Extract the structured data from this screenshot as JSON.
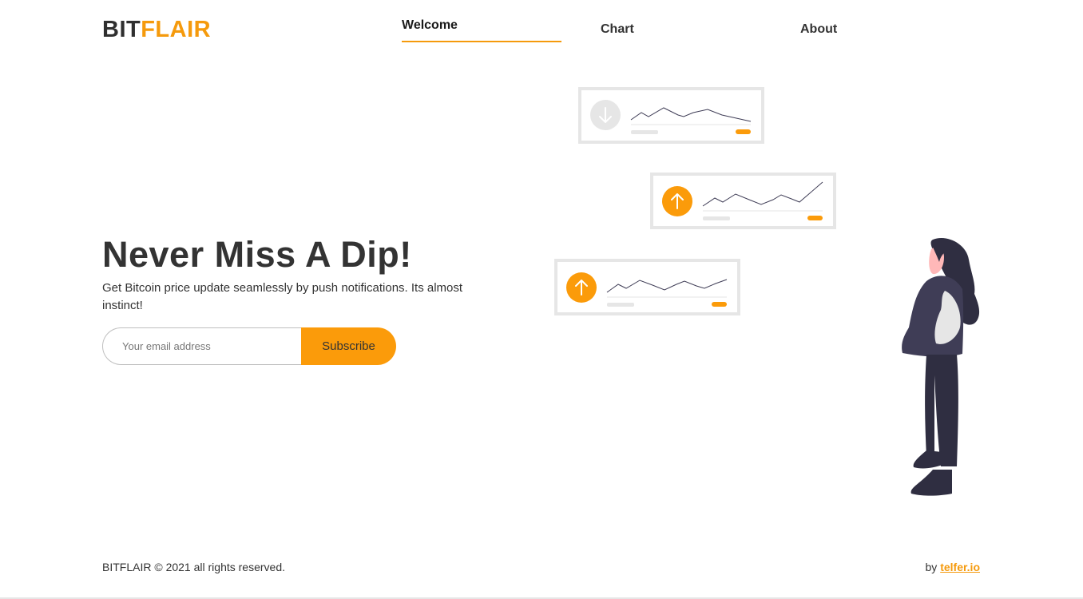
{
  "brand": {
    "part1": "BIT",
    "part2": "FLAIR"
  },
  "nav": {
    "items": [
      {
        "label": "Welcome",
        "active": true
      },
      {
        "label": "Chart",
        "active": false
      },
      {
        "label": "About",
        "active": false
      }
    ]
  },
  "hero": {
    "headline": "Never Miss A Dip!",
    "subtext": "Get Bitcoin price update seamlessly by push notifications. Its almost instinct!"
  },
  "subscribe": {
    "email_placeholder": "Your email address",
    "email_value": "",
    "button_label": "Subscribe"
  },
  "illustration": {
    "cards": [
      {
        "direction": "down",
        "icon": "arrow-down-icon",
        "active": false
      },
      {
        "direction": "up",
        "icon": "arrow-up-icon",
        "active": true
      },
      {
        "direction": "up",
        "icon": "arrow-up-icon",
        "active": true
      }
    ]
  },
  "footer": {
    "brand": "BITFLAIR",
    "copyright_symbol": "©",
    "copyright_text": "2021 all rights reserved.",
    "by_label": "by",
    "by_link": "telfer.io"
  },
  "colors": {
    "accent": "#f59a0c",
    "button": "#fb9b0a",
    "text": "#333333",
    "card_border": "#e6e6e6",
    "figure_dark": "#2f2e41"
  }
}
